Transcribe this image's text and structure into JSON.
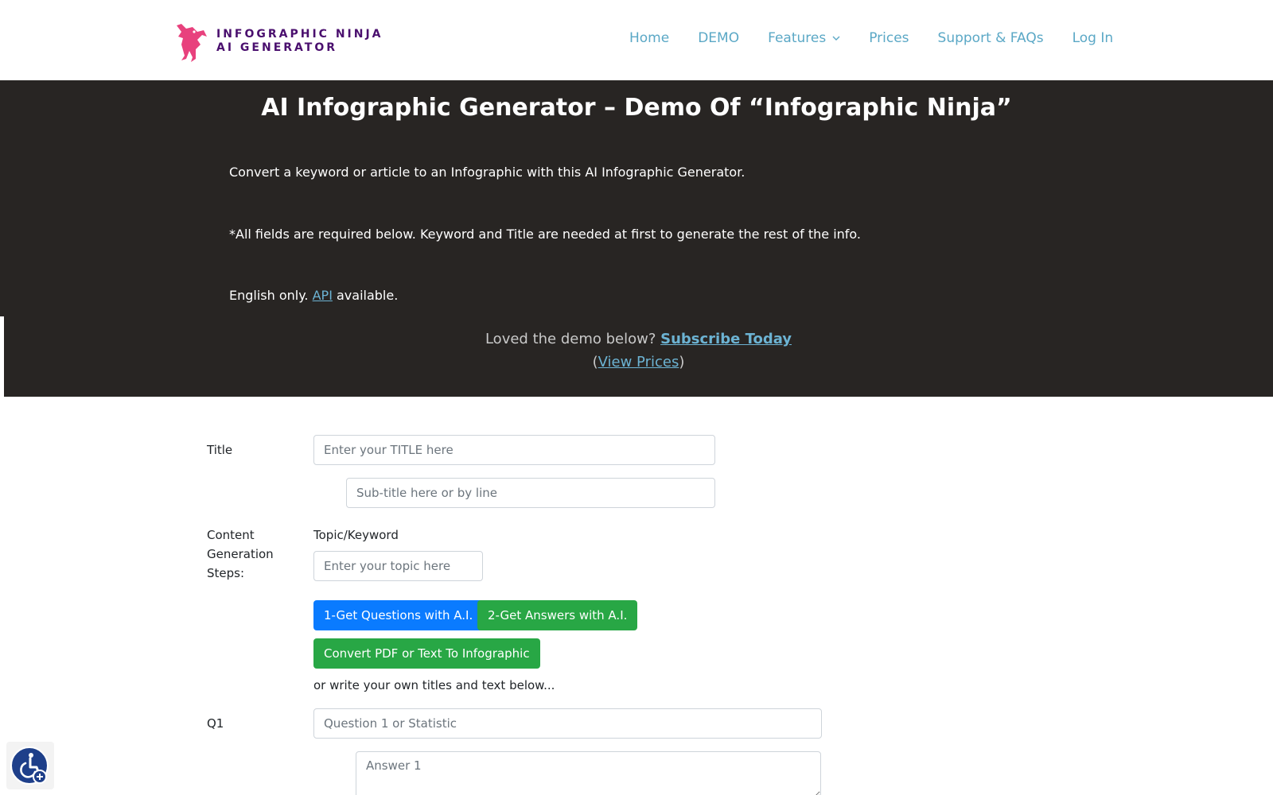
{
  "header": {
    "logo_line1": "INFOGRAPHIC NINJA",
    "logo_line2": "AI GENERATOR",
    "nav": [
      {
        "label": "Home"
      },
      {
        "label": "DEMO"
      },
      {
        "label": "Features"
      },
      {
        "label": "Prices"
      },
      {
        "label": "Support & FAQs"
      },
      {
        "label": "Log In"
      }
    ]
  },
  "hero": {
    "title": "AI Infographic Generator – Demo Of “Infographic Ninja”",
    "p1": "Convert a keyword or article to an Infographic with this AI Infographic Generator.",
    "p2": "*All fields are required below. Keyword and Title are needed at first to generate the rest of the info.",
    "p3_prefix": "English only. ",
    "p3_link": "API",
    "p3_suffix": " available.",
    "loved_prefix": "Loved the demo below? ",
    "subscribe": "Subscribe Today",
    "paren_open": "(",
    "view_prices": "View Prices",
    "paren_close": ")"
  },
  "form": {
    "title_label": "Title",
    "title_placeholder": "Enter your TITLE here",
    "subtitle_placeholder": "Sub-title here or by line",
    "steps_label_1": "Content",
    "steps_label_2": "Generation",
    "steps_label_3": "Steps:",
    "topic_label": "Topic/Keyword",
    "topic_placeholder": "Enter your topic here",
    "btn_questions": "1-Get Questions with A.I.",
    "btn_answers": "2-Get Answers with A.I.",
    "btn_convert": "Convert PDF or Text To Infographic",
    "own_text": "or write your own titles and text below...",
    "q1_label": "Q1",
    "q1_placeholder": "Question 1 or Statistic",
    "a1_placeholder": "Answer 1"
  },
  "icons": {
    "logo": "ninja-logo-icon",
    "chevron": "chevron-down-icon",
    "accessibility": "accessibility-icon"
  },
  "colors": {
    "brand_pink": "#e8417d",
    "brand_purple": "#4a0f6e",
    "nav_link": "#5ba8c6",
    "hero_bg": "#282523",
    "btn_blue": "#0a7bff",
    "btn_green": "#28a745"
  }
}
